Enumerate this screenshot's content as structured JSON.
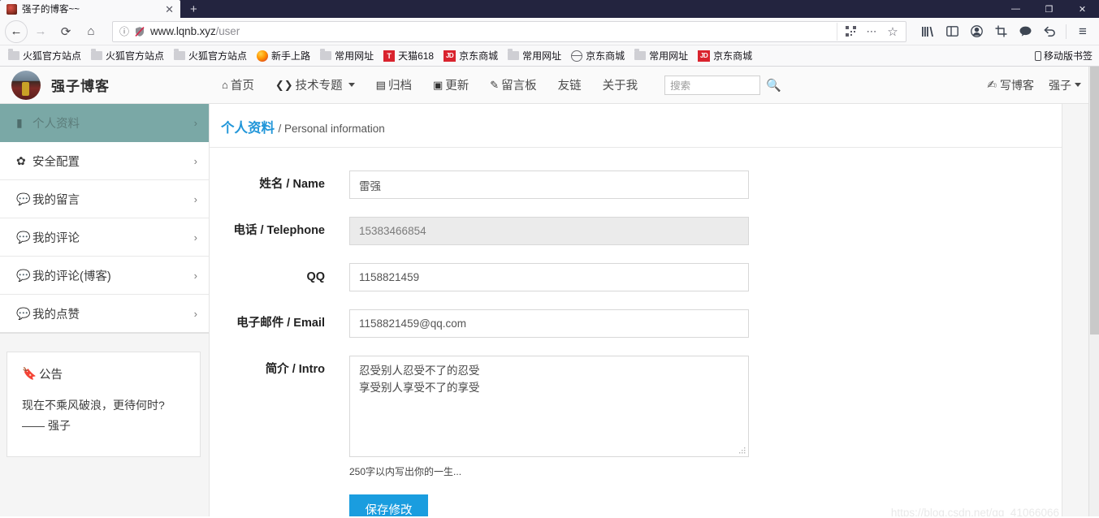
{
  "browser": {
    "tab": {
      "title": "强子的博客~~",
      "favicon": "site-favicon",
      "close_label": "✕"
    },
    "new_tab_label": "+",
    "window_controls": {
      "minimize": "—",
      "maximize": "❐",
      "close": "✕"
    },
    "nav": {
      "back": "←",
      "forward": "→",
      "reload": "⟳",
      "home": "⌂"
    },
    "url": {
      "prefix": "www.lqnb.xyz",
      "path": "/user",
      "info_icon": "ⓘ",
      "tracking_icon": "shield-strikethrough-icon"
    },
    "url_actions": {
      "qr": "qr-code-icon",
      "more": "⋯",
      "bookmark": "☆"
    },
    "toolbar_icons": [
      "library-icon",
      "sidebar-icon",
      "account-icon",
      "screenshot-icon",
      "chat-icon",
      "undo-icon",
      "menu-icon"
    ],
    "bookmarks": [
      {
        "label": "火狐官方站点",
        "icon": "folder-icon"
      },
      {
        "label": "火狐官方站点",
        "icon": "folder-icon"
      },
      {
        "label": "火狐官方站点",
        "icon": "folder-icon"
      },
      {
        "label": "新手上路",
        "icon": "firefox-icon"
      },
      {
        "label": "常用网址",
        "icon": "folder-icon"
      },
      {
        "label": "天猫618",
        "icon": "tmall-icon"
      },
      {
        "label": "京东商城",
        "icon": "jd-icon"
      },
      {
        "label": "常用网址",
        "icon": "folder-icon"
      },
      {
        "label": "京东商城",
        "icon": "globe-icon"
      },
      {
        "label": "常用网址",
        "icon": "folder-icon"
      },
      {
        "label": "京东商城",
        "icon": "jd-icon"
      }
    ],
    "bookmarks_right": {
      "label": "移动版书签",
      "icon": "phone-icon"
    }
  },
  "site": {
    "brand": {
      "name": "强子博客",
      "avatar": "user-avatar"
    },
    "nav": [
      {
        "label": "首页",
        "icon": "home-icon",
        "has_caret": false
      },
      {
        "label": "技术专题",
        "icon": "code-icon",
        "has_caret": true
      },
      {
        "label": "归档",
        "icon": "archive-icon",
        "has_caret": false
      },
      {
        "label": "更新",
        "icon": "calendar-icon",
        "has_caret": false
      },
      {
        "label": "留言板",
        "icon": "pencil-icon",
        "has_caret": false
      },
      {
        "label": "友链",
        "icon": "",
        "has_caret": false
      },
      {
        "label": "关于我",
        "icon": "",
        "has_caret": false
      }
    ],
    "search": {
      "placeholder": "搜索",
      "value": "",
      "icon": "search-icon"
    },
    "header_right": {
      "write_blog": {
        "label": "写博客",
        "icon": "write-icon"
      },
      "user": {
        "label": "强子",
        "caret": "▾"
      }
    }
  },
  "sidebar": {
    "items": [
      {
        "label": "个人资料",
        "icon": "file-icon",
        "arrow": "›",
        "active": true
      },
      {
        "label": "安全配置",
        "icon": "gear-icon",
        "arrow": "›",
        "active": false
      },
      {
        "label": "我的留言",
        "icon": "comments-icon",
        "arrow": "›",
        "active": false
      },
      {
        "label": "我的评论",
        "icon": "comment-icon",
        "arrow": "›",
        "active": false
      },
      {
        "label": "我的评论(博客)",
        "icon": "comment-icon",
        "arrow": "›",
        "active": false
      },
      {
        "label": "我的点赞",
        "icon": "comment-icon",
        "arrow": "›",
        "active": false
      }
    ],
    "notice": {
      "title": "公告",
      "icon": "bookmark-flag-icon",
      "line1": "现在不乘风破浪，更待何时?",
      "line2": "—— 强子"
    }
  },
  "main": {
    "heading_cn": "个人资料",
    "heading_en": "/ Personal information",
    "fields": [
      {
        "label": "姓名 / Name",
        "value": "雷强",
        "disabled": false,
        "name": "name-field"
      },
      {
        "label": "电话 / Telephone",
        "value": "15383466854",
        "disabled": true,
        "name": "telephone-field"
      },
      {
        "label": "QQ",
        "value": "1158821459",
        "disabled": false,
        "name": "qq-field"
      },
      {
        "label": "电子邮件 / Email",
        "value": "1158821459@qq.com",
        "disabled": false,
        "name": "email-field"
      }
    ],
    "intro": {
      "label": "简介 / Intro",
      "value": " 忍受别人忍受不了的忍受\n享受别人享受不了的享受",
      "hint": "250字以内写出你的一生..."
    },
    "save_label": "保存修改",
    "watermark": "https://blog.csdn.net/qq_41066066"
  },
  "colors": {
    "titlebar": "#23243f",
    "sidebar_active": "#7aa8a6",
    "accent_blue": "#2196d9",
    "save_button": "#1a9ddf",
    "page_bg": "#f5f5f5"
  }
}
